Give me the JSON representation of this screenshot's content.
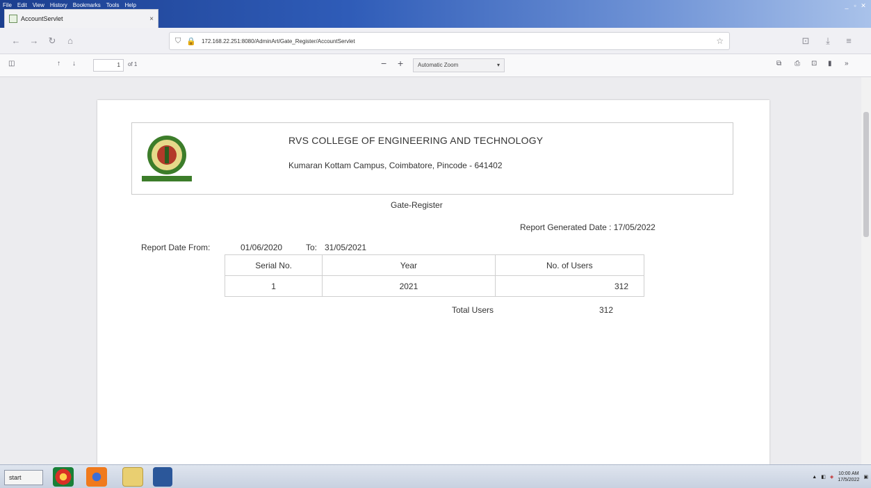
{
  "menubar": [
    "File",
    "Edit",
    "View",
    "History",
    "Bookmarks",
    "Tools",
    "Help"
  ],
  "window_controls": [
    "_",
    "▫",
    "✕"
  ],
  "tab": {
    "title": "AccountServlet",
    "close": "×"
  },
  "nav": {
    "back": "←",
    "forward": "→",
    "reload": "↻",
    "home": "⌂",
    "url": "172.16.22.251/Aadyhl/Gate_Register/AccountServlet",
    "url_display": "172.168.22.251:8080/AdminArt/Gate_Register/AccountServlet",
    "shield": "⛉",
    "lock": "🔒",
    "star": "☆",
    "pocket": "⊡",
    "download": "⤓",
    "menu": "≡"
  },
  "pdf_toolbar": {
    "sidebar_toggle": "◫",
    "prev": "↑",
    "next": "↓",
    "page_number": "1",
    "page_count": "of 1",
    "zoom_out": "−",
    "zoom_in": "+",
    "zoom_value": "Automatic Zoom",
    "zoom_arrow": "▾",
    "right_icons": [
      "⧉",
      "⎙",
      "⊡",
      "▮",
      "»"
    ]
  },
  "report": {
    "college_name": "RVS COLLEGE OF ENGINEERING AND TECHNOLOGY",
    "address": "Kumaran Kottam Campus, Coimbatore, Pincode - 641402",
    "title": "Gate-Register",
    "generated_label": "Report Generated Date : 17/05/2022",
    "date_range_label": "Report Date From:",
    "date_from": "01/06/2020",
    "to_label": "To:",
    "date_to": "31/05/2021",
    "table": {
      "headers": [
        "Serial No.",
        "Year",
        "No. of Users"
      ],
      "rows": [
        [
          "1",
          "2021",
          "312"
        ]
      ]
    },
    "total_label": "Total Users",
    "total_value": "312"
  },
  "taskbar": {
    "start": "start",
    "tray_time": "10:00 AM",
    "tray_date": "17/5/2022"
  }
}
